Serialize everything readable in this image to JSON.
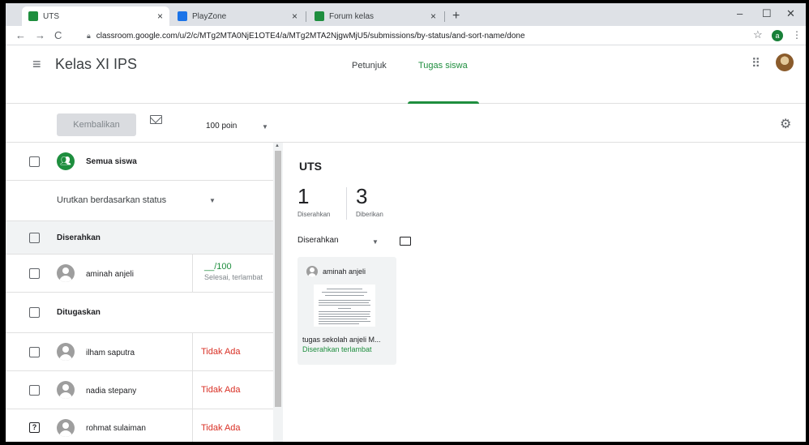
{
  "browser": {
    "tabs": [
      {
        "title": "UTS",
        "active": true,
        "favicon_color": "#1e8e3e"
      },
      {
        "title": "PlayZone",
        "active": false,
        "favicon_color": "#1a73e8"
      },
      {
        "title": "Forum kelas",
        "active": false,
        "favicon_color": "#1e8e3e"
      }
    ],
    "close_glyph": "×",
    "new_tab_glyph": "+",
    "url": "classroom.google.com/u/2/c/MTg2MTA0NjE1OTE4/a/MTg2MTA2NjgwMjU5/submissions/by-status/and-sort-name/done",
    "profile_letter": "a",
    "window": {
      "minimize": "–",
      "maximize": "☐",
      "close": "✕"
    }
  },
  "header": {
    "class_name": "Kelas XI IPS",
    "tabs": [
      {
        "label": "Petunjuk",
        "selected": false
      },
      {
        "label": "Tugas siswa",
        "selected": true
      }
    ]
  },
  "toolbar": {
    "return_label": "Kembalikan",
    "points_label": "100 poin"
  },
  "roster": {
    "all_students": "Semua siswa",
    "sort_label": "Urutkan berdasarkan status",
    "group_submitted": "Diserahkan",
    "group_assigned": "Ditugaskan",
    "submitted_students": [
      {
        "name": "aminah anjeli",
        "grade": "__/100",
        "grade_status": "Selesai, terlambat"
      }
    ],
    "assigned_students": [
      {
        "name": "ilham saputra",
        "status": "Tidak Ada"
      },
      {
        "name": "nadia stepany",
        "status": "Tidak Ada"
      },
      {
        "name": "rohmat sulaiman",
        "status": "Tidak Ada"
      }
    ]
  },
  "detail": {
    "assignment_title": "UTS",
    "submitted_count": "1",
    "submitted_label": "Diserahkan",
    "assigned_count": "3",
    "assigned_label": "Diberikan",
    "filter_label": "Diserahkan",
    "card": {
      "student": "aminah anjeli",
      "file_title": "tugas sekolah anjeli M...",
      "status": "Diserahkan terlambat"
    }
  },
  "colors": {
    "accent": "#1e8e3e",
    "missing": "#d93025"
  }
}
